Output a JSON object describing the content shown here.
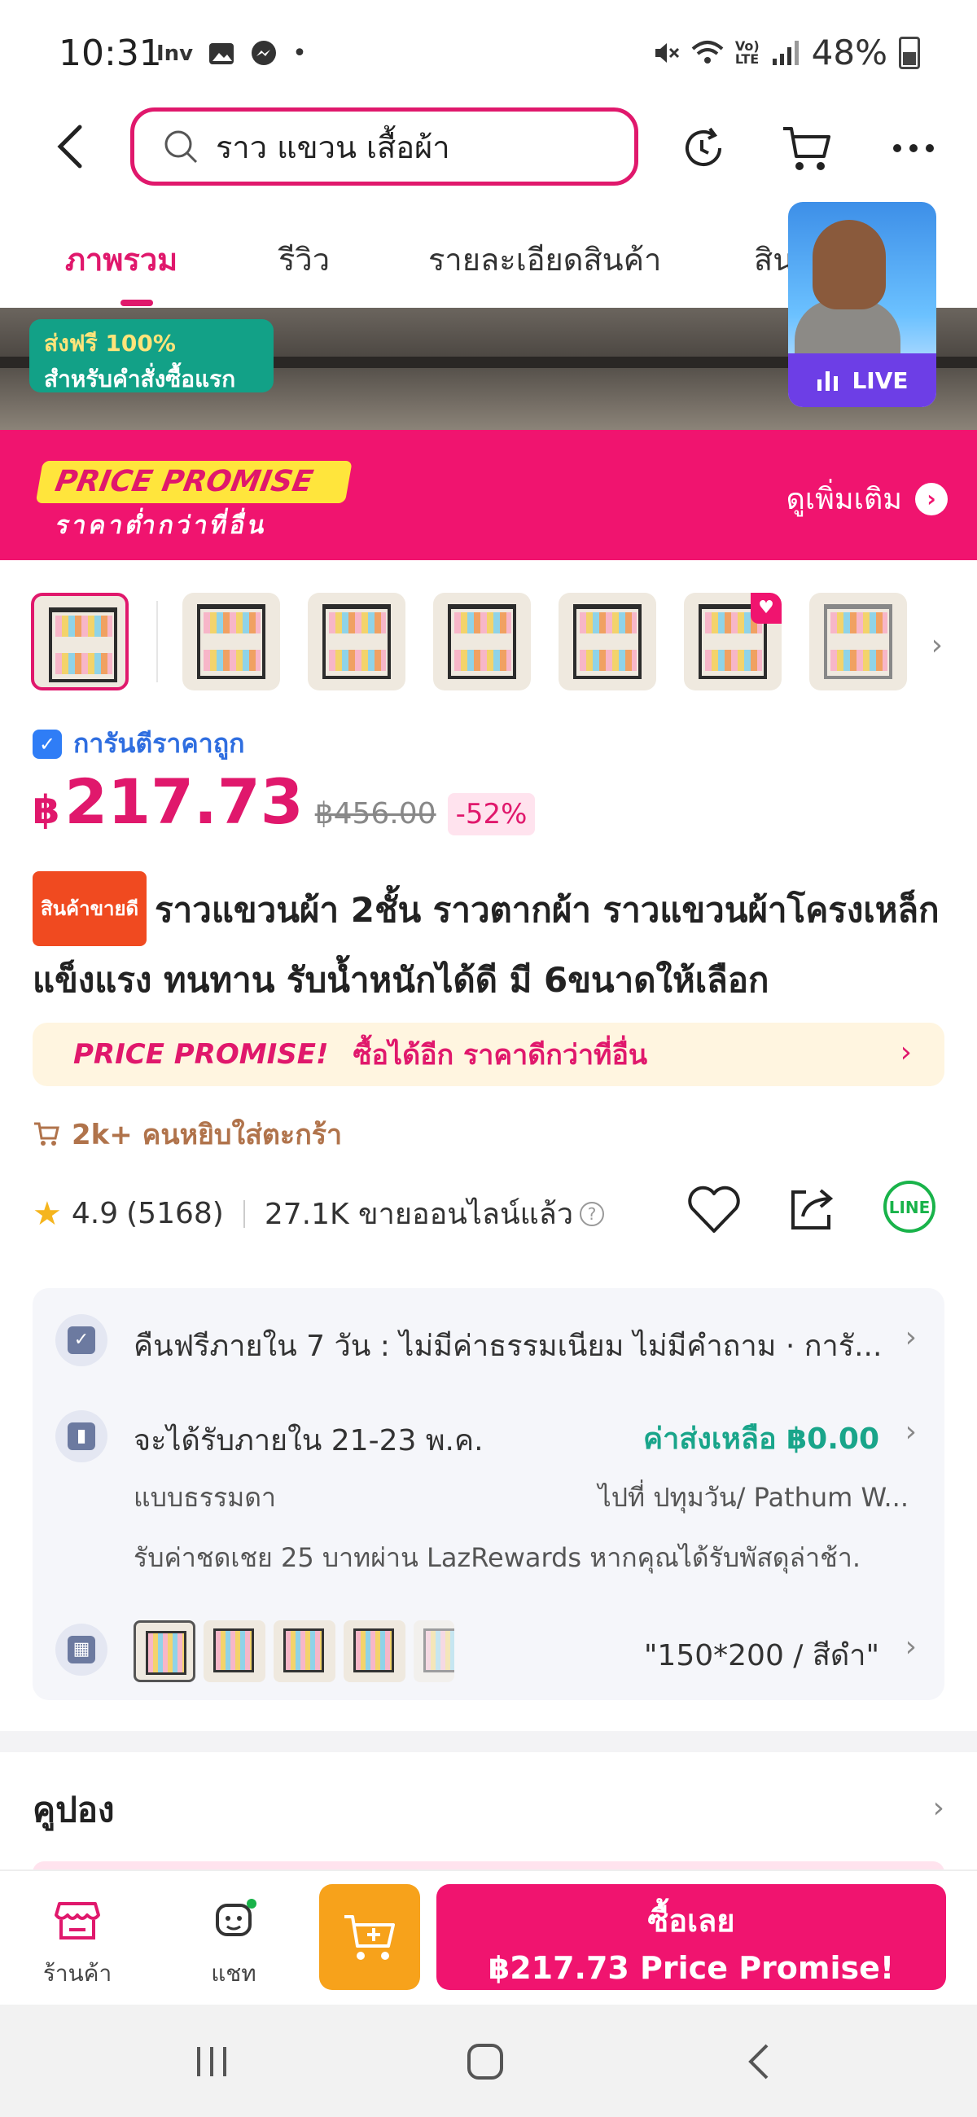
{
  "status_bar": {
    "time": "10:31",
    "battery": "48%",
    "left_icons": [
      "Inv",
      "gallery-icon",
      "messenger-icon",
      "•"
    ],
    "right_icons": [
      "mute-icon",
      "wifi-icon",
      "volte-icon",
      "signal-icon"
    ]
  },
  "search": {
    "query": "ราว แขวน เสื้อผ้า"
  },
  "tabs": [
    {
      "label": "ภาพรวม",
      "active": true
    },
    {
      "label": "รีวิว",
      "active": false
    },
    {
      "label": "รายละเอียดสินค้า",
      "active": false
    },
    {
      "label": "สิน",
      "active": false
    }
  ],
  "hero": {
    "free_ship_line1": "ส่งฟรี 100%",
    "free_ship_line2": "สำหรับคำสั่งซื้อแรก"
  },
  "live": {
    "label": "LIVE"
  },
  "price_promise_banner": {
    "badge_en": "PRICE PROMISE",
    "badge_th": "ราคาต่ำกว่าที่อื่น",
    "more_label": "ดูเพิ่มเติม"
  },
  "price": {
    "guarantee_label": "การันตีราคาถูก",
    "currency": "฿",
    "current": "217.73",
    "original": "฿456.00",
    "discount": "-52%"
  },
  "product": {
    "tag": "สินค้าขายดี",
    "title": "ราวแขวนผ้า 2ชั้น ราวตากผ้า ราวแขวนผ้าโครงเหล็ก แข็งแรง ทนทาน รับน้ำหนักได้ดี มี 6ขนาดให้เลือก"
  },
  "promise_strip": {
    "logo": "PRICE PROMISE!",
    "text": "ซื้อได้อีก ราคาดีกว่าที่อื่น"
  },
  "cart_count": "2k+ คนหยิบใส่ตะกร้า",
  "rating": {
    "score": "4.9",
    "count": "(5168)",
    "sold": "27.1K ขายออนไลน์แล้ว",
    "help": "?"
  },
  "service": {
    "return_text": "คืนฟรีภายใน 7 วัน : ไม่มีค่าธรรมเนียม ไม่มีคำถาม · การั...",
    "delivery_text": "จะได้รับภายใน 21-23 พ.ค.",
    "shipping_fee": "ค่าส่งเหลือ ฿0.00",
    "shipping_type": "แบบธรรมดา",
    "destination": "ไปที่ ปทุมวัน/ Pathum W...",
    "compensation": "รับค่าชดเชย 25 บาทผ่าน LazRewards หากคุณได้รับพัสดุล่าช้า.",
    "variant": "\"150*200 / สีดำ\""
  },
  "coupon": {
    "title": "คูปอง"
  },
  "bottom_bar": {
    "store_label": "ร้านค้า",
    "chat_label": "แชท",
    "buy_line1": "ซื้อเลย",
    "buy_line2": "฿217.73 Price Promise!"
  },
  "colors": {
    "brand_pink": "#e0186c",
    "banner_pink": "#f0146f",
    "cart_orange": "#f7a21b",
    "green": "#19a58a",
    "guarantee_blue": "#2f6ee0"
  }
}
